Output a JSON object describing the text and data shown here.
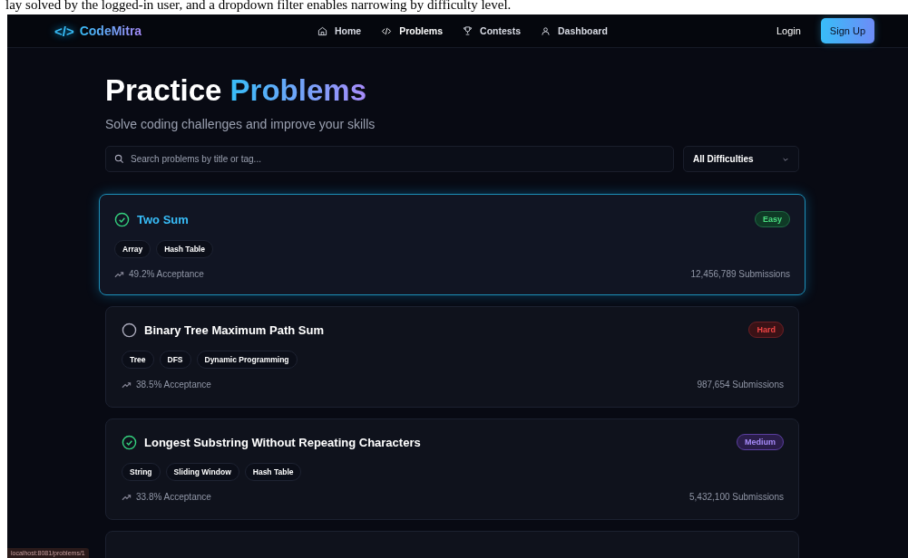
{
  "caption": "lay solved by the logged-in user, and a dropdown filter enables narrowing by difficulty level.",
  "nav": {
    "logo_mark": "</>",
    "logo_text": "CodeMitra",
    "links": [
      {
        "label": "Home",
        "kind": "home",
        "selected": false
      },
      {
        "label": "Problems",
        "kind": "code",
        "selected": true
      },
      {
        "label": "Contests",
        "kind": "trophy",
        "selected": false
      },
      {
        "label": "Dashboard",
        "kind": "user",
        "selected": false
      }
    ],
    "login": "Login",
    "signup": "Sign Up"
  },
  "heading": {
    "plain": "Practice",
    "accent": "Problems"
  },
  "subtitle": "Solve coding challenges and improve your skills",
  "search": {
    "placeholder": "Search problems by title or tag..."
  },
  "filter": {
    "value": "All Difficulties"
  },
  "problems": [
    {
      "title": "Two Sum",
      "solved": true,
      "selected": true,
      "difficulty": "Easy",
      "kind": "easy",
      "tags": [
        "Array",
        "Hash Table"
      ],
      "acceptance": "49.2% Acceptance",
      "submissions": "12,456,789 Submissions"
    },
    {
      "title": "Binary Tree Maximum Path Sum",
      "solved": false,
      "selected": false,
      "difficulty": "Hard",
      "kind": "hard",
      "tags": [
        "Tree",
        "DFS",
        "Dynamic Programming"
      ],
      "acceptance": "38.5% Acceptance",
      "submissions": "987,654 Submissions"
    },
    {
      "title": "Longest Substring Without Repeating Characters",
      "solved": true,
      "selected": false,
      "difficulty": "Medium",
      "kind": "medium",
      "tags": [
        "String",
        "Sliding Window",
        "Hash Table"
      ],
      "acceptance": "33.8% Acceptance",
      "submissions": "5,432,100 Submissions"
    }
  ],
  "status_url": "localhost:8081/problems/1"
}
